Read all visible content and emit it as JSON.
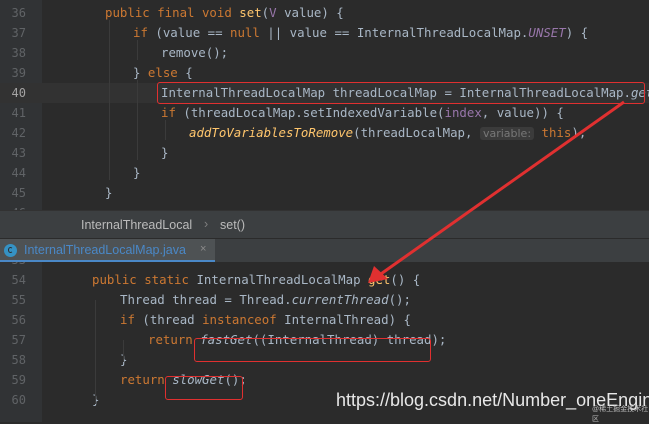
{
  "top_code": {
    "lines": [
      {
        "n": "36",
        "tokens": [
          [
            "kw",
            "public final void "
          ],
          [
            "fn",
            "set"
          ],
          [
            "",
            "("
          ],
          [
            "tp",
            "V"
          ],
          [
            "",
            " value) {"
          ]
        ]
      },
      {
        "n": "37",
        "tokens": [
          [
            "kw",
            "if "
          ],
          [
            "",
            "(value == "
          ],
          [
            "kw",
            "null"
          ],
          [
            "",
            " || value == InternalThreadLocalMap."
          ],
          [
            "tp it",
            "UNSET"
          ],
          [
            "",
            ") {"
          ]
        ]
      },
      {
        "n": "38",
        "tokens": [
          [
            "",
            "remove();"
          ]
        ]
      },
      {
        "n": "39",
        "tokens": [
          [
            "",
            "} "
          ],
          [
            "kw",
            "else "
          ],
          [
            "",
            "{"
          ]
        ]
      },
      {
        "n": "40",
        "tokens": [
          [
            "",
            "InternalThreadLocalMap threadLocalMap = InternalThreadLocalMap."
          ],
          [
            "it",
            "get"
          ],
          [
            "",
            "();"
          ]
        ]
      },
      {
        "n": "41",
        "tokens": [
          [
            "kw",
            "if "
          ],
          [
            "",
            "(threadLocalMap.setIndexedVariable("
          ],
          [
            "tp",
            "index"
          ],
          [
            "",
            ", value)) {"
          ]
        ]
      },
      {
        "n": "42",
        "tokens": [
          [
            "it fn",
            "addToVariablesToRemove"
          ],
          [
            "",
            "(threadLocalMap, "
          ],
          [
            "hint",
            "variable:"
          ],
          [
            "",
            " "
          ],
          [
            "kw",
            "this"
          ],
          [
            "",
            ");"
          ]
        ]
      },
      {
        "n": "43",
        "tokens": [
          [
            "",
            "}"
          ]
        ]
      },
      {
        "n": "44",
        "tokens": [
          [
            "",
            "}"
          ]
        ]
      },
      {
        "n": "45",
        "tokens": [
          [
            "",
            "}"
          ]
        ]
      },
      {
        "n": "46",
        "tokens": []
      }
    ]
  },
  "breadcrumb": {
    "items": [
      "InternalThreadLocal",
      "set()"
    ]
  },
  "tab": {
    "label": "InternalThreadLocalMap.java",
    "close": "×"
  },
  "bottom_code": {
    "lines": [
      {
        "n": "53",
        "tokens": []
      },
      {
        "n": "54",
        "tokens": [
          [
            "kw",
            "public static "
          ],
          [
            "",
            "InternalThreadLocalMap "
          ],
          [
            "fn",
            "get"
          ],
          [
            "",
            "() {"
          ]
        ]
      },
      {
        "n": "55",
        "tokens": [
          [
            "",
            "Thread thread = Thread."
          ],
          [
            "it",
            "currentThread"
          ],
          [
            "",
            "();"
          ]
        ]
      },
      {
        "n": "56",
        "tokens": [
          [
            "kw",
            "if "
          ],
          [
            "",
            "(thread "
          ],
          [
            "kw",
            "instanceof "
          ],
          [
            "",
            "InternalThread) {"
          ]
        ]
      },
      {
        "n": "57",
        "tokens": [
          [
            "kw",
            "return "
          ],
          [
            "it",
            "fastGet"
          ],
          [
            "",
            "((InternalThread) thread);"
          ]
        ]
      },
      {
        "n": "58",
        "tokens": [
          [
            "",
            "}"
          ]
        ]
      },
      {
        "n": "59",
        "tokens": [
          [
            "kw",
            "return "
          ],
          [
            "it",
            "slowGet"
          ],
          [
            "",
            "();"
          ]
        ]
      },
      {
        "n": "60",
        "tokens": [
          [
            "",
            "}"
          ]
        ]
      }
    ]
  },
  "watermark": {
    "text": "https://blog.csdn.net/Number_oneEngineer",
    "small": "@稀土掘金技术社区"
  },
  "colors": {
    "annotation": "#e03030",
    "tab_accent": "#4a88c7"
  }
}
